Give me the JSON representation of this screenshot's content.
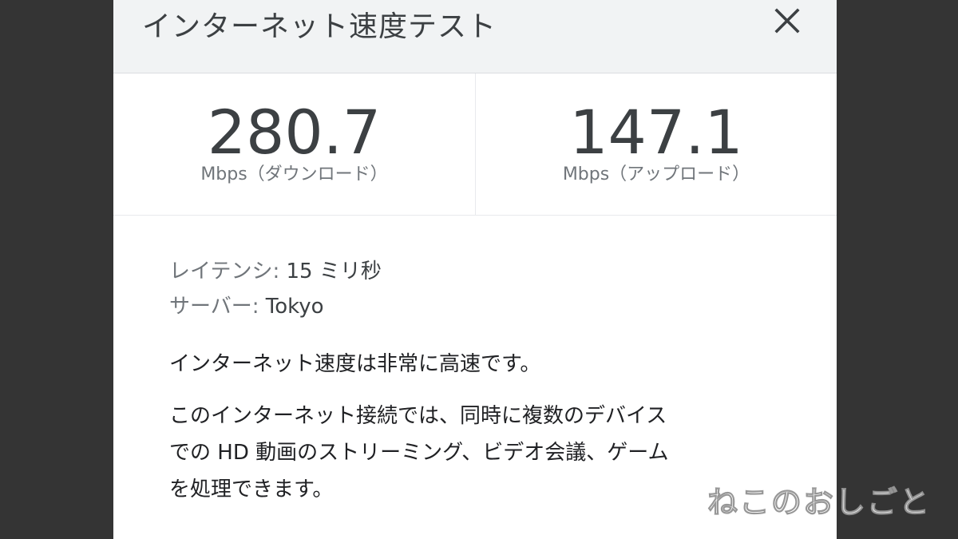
{
  "dialog": {
    "title": "インターネット速度テスト",
    "close_icon": "close-icon"
  },
  "results": {
    "download": {
      "value": "280.7",
      "unit": "Mbps（ダウンロード）"
    },
    "upload": {
      "value": "147.1",
      "unit": "Mbps（アップロード）"
    }
  },
  "details": {
    "latency_label": "レイテンシ:",
    "latency_value": "15 ミリ秒",
    "server_label": "サーバー:",
    "server_value": "Tokyo",
    "summary": "インターネット速度は非常に高速です。",
    "description_lines": [
      "このインターネット接続では、同時に複数のデバイス",
      "での HD 動画のストリーミング、ビデオ会議、ゲーム",
      "を処理できます。"
    ]
  },
  "watermark": "ねこのおしごと",
  "colors": {
    "background": "#343434",
    "header": "#f1f3f4",
    "text_primary": "#3c4043",
    "text_secondary": "#70757a"
  }
}
